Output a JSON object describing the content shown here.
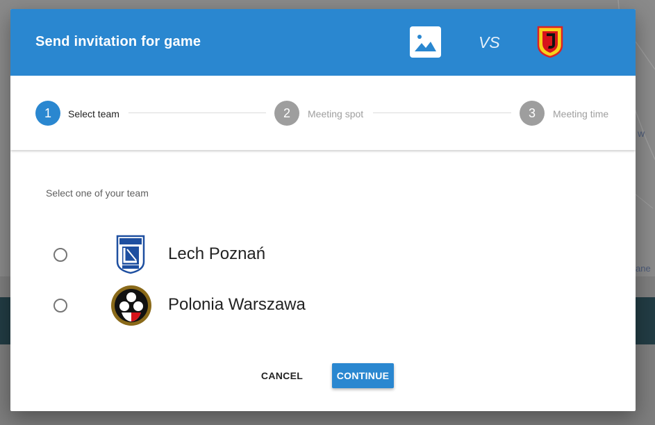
{
  "background": {
    "map_text_partial": "w",
    "map_link_partial": "ane"
  },
  "dialog": {
    "title": "Send invitation for game",
    "vs_label": "VS",
    "team_image_icon": "image-placeholder-icon",
    "opponent_crest": "jagiellonia-crest"
  },
  "stepper": {
    "steps": [
      {
        "number": "1",
        "label": "Select team",
        "state": "active"
      },
      {
        "number": "2",
        "label": "Meeting spot",
        "state": "inactive"
      },
      {
        "number": "3",
        "label": "Meeting time",
        "state": "inactive"
      }
    ]
  },
  "team_select": {
    "prompt": "Select one of your team",
    "selected_index": null,
    "teams": [
      {
        "name": "Lech Poznań",
        "crest": "lech-poznan-crest",
        "crest_text": "KKS LECH 1922 POZNAŃ"
      },
      {
        "name": "Polonia Warszawa",
        "crest": "polonia-warszawa-crest",
        "crest_text": "KSP POLONIA 1911"
      }
    ]
  },
  "actions": {
    "cancel_label": "CANCEL",
    "continue_label": "CONTINUE"
  },
  "colors": {
    "primary": "#2a87d0",
    "step_inactive": "#9e9e9e",
    "overlay_band": "#223c44"
  }
}
